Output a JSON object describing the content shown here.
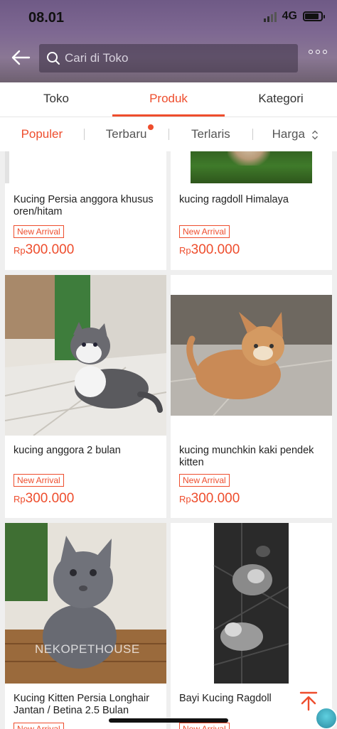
{
  "status_bar": {
    "time": "08.01",
    "network": "4G"
  },
  "search": {
    "placeholder": "Cari di Toko"
  },
  "tabs": [
    {
      "label": "Toko",
      "active": false
    },
    {
      "label": "Produk",
      "active": true
    },
    {
      "label": "Kategori",
      "active": false
    }
  ],
  "sort": [
    {
      "label": "Populer",
      "active": true
    },
    {
      "label": "Terbaru",
      "has_dot": true
    },
    {
      "label": "Terlaris"
    },
    {
      "label": "Harga"
    }
  ],
  "products": [
    {
      "title": "Kucing Persia anggora khusus oren/hitam",
      "badge": "New Arrival",
      "currency": "Rp",
      "price": "300.000"
    },
    {
      "title": "kucing ragdoll Himalaya",
      "badge": "New Arrival",
      "currency": "Rp",
      "price": "300.000"
    },
    {
      "title": "kucing anggora 2 bulan",
      "badge": "New Arrival",
      "currency": "Rp",
      "price": "300.000"
    },
    {
      "title": "kucing munchkin kaki pendek kitten",
      "badge": "New Arrival",
      "currency": "Rp",
      "price": "300.000"
    },
    {
      "title": "Kucing Kitten Persia Longhair Jantan / Betina 2.5 Bulan",
      "badge": "New Arrival",
      "watermark": "NEKOPETHOUSE"
    },
    {
      "title": "Bayi Kucing Ragdoll",
      "badge": "New Arrival"
    }
  ],
  "colors": {
    "accent": "#ee4d2d"
  }
}
